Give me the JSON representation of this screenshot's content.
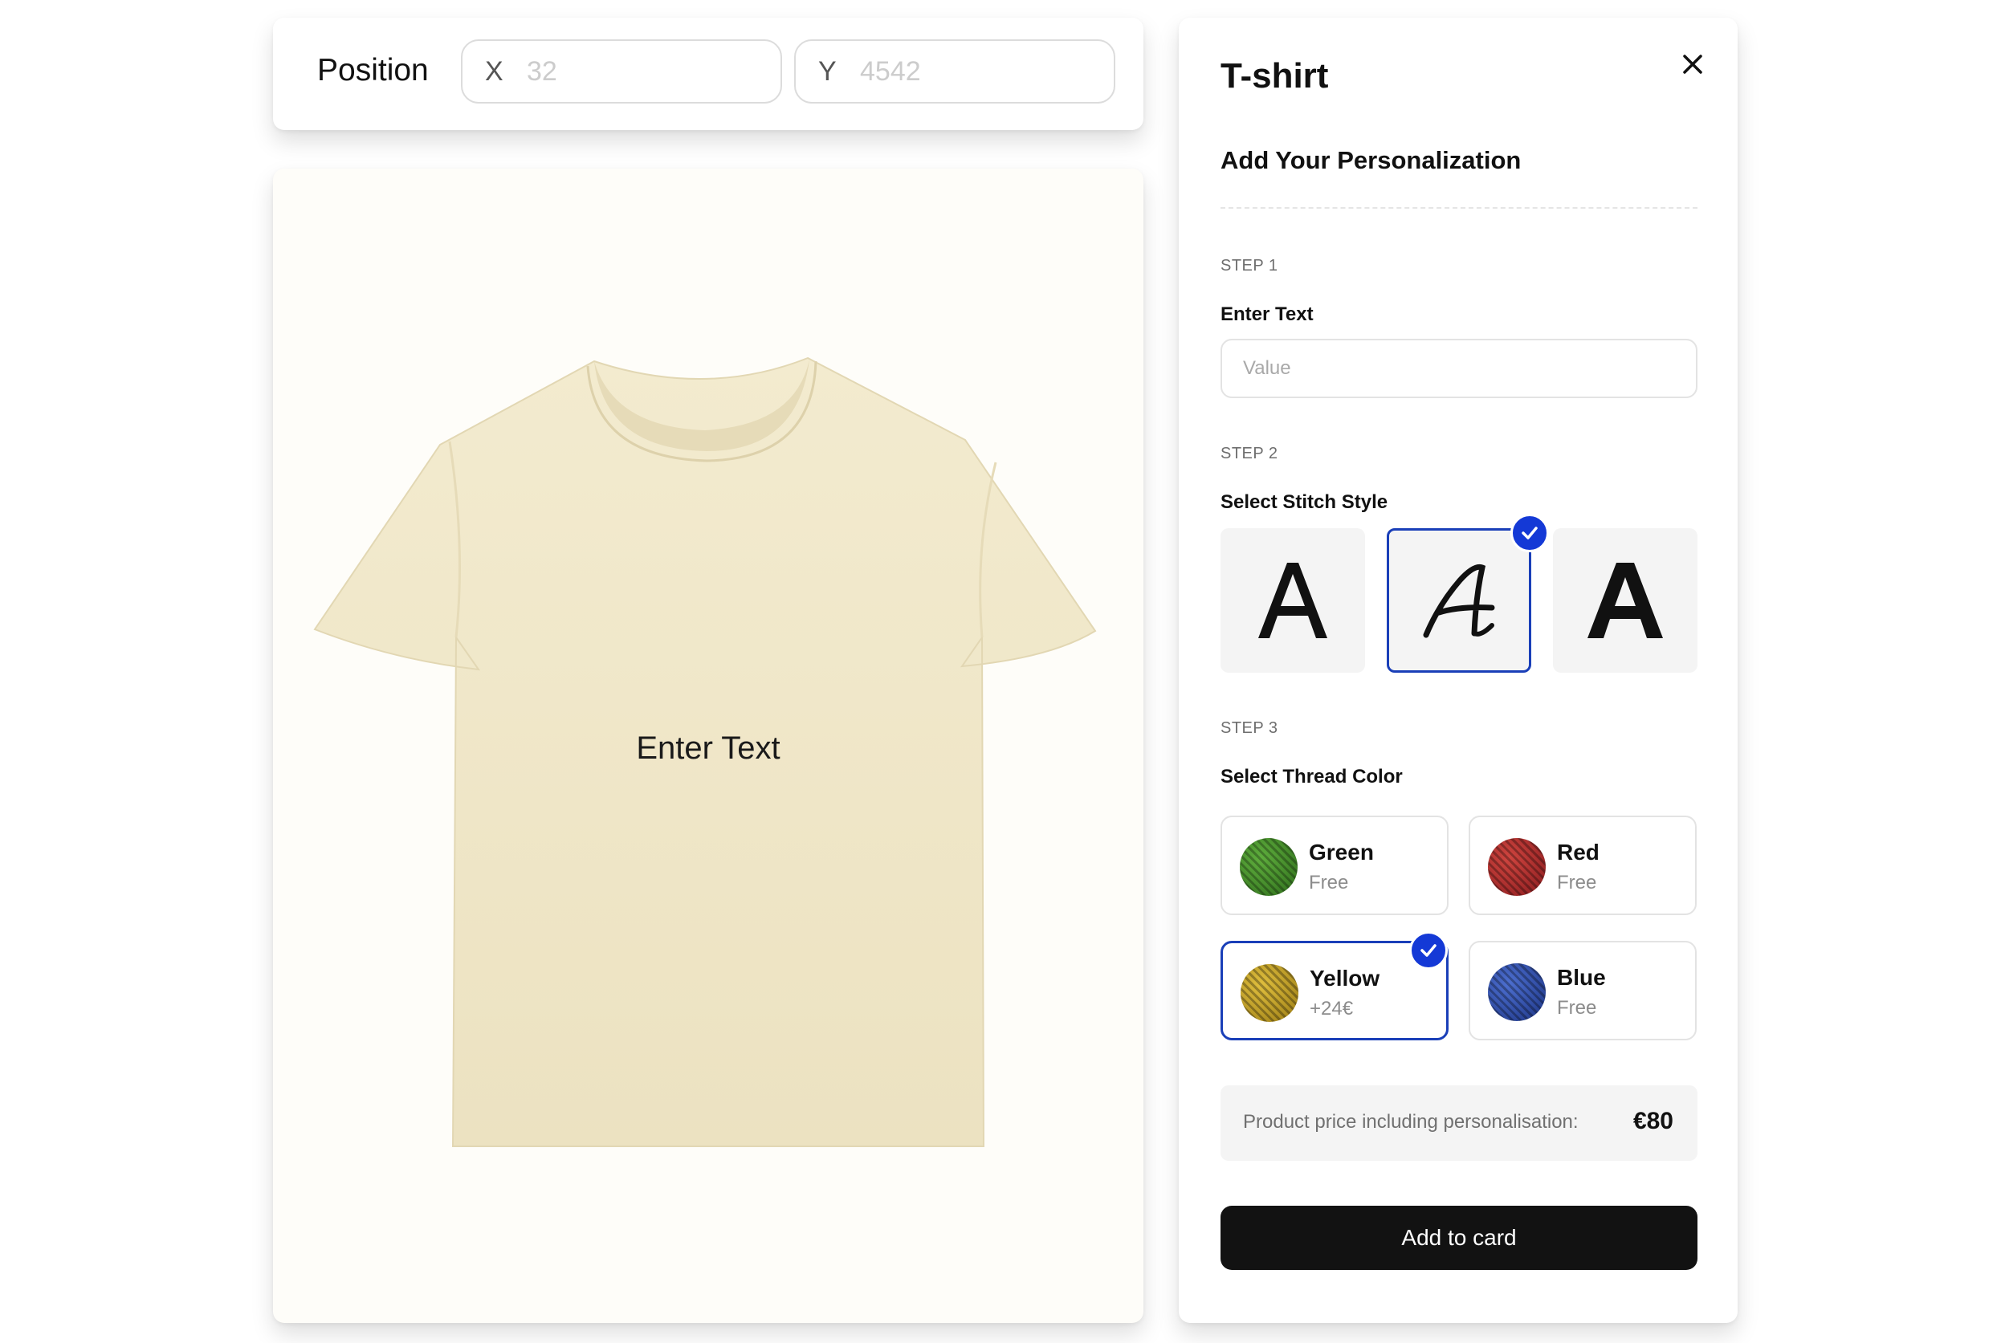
{
  "position": {
    "label": "Position",
    "x": {
      "axis": "X",
      "placeholder": "32"
    },
    "y": {
      "axis": "Y",
      "placeholder": "4542"
    }
  },
  "preview": {
    "shirt_text": "Enter Text",
    "shirt_color": "#f1e9cc"
  },
  "panel": {
    "title": "T-shirt",
    "subtitle": "Add Your Personalization",
    "step1": {
      "label": "STEP 1",
      "field_label": "Enter Text",
      "placeholder": "Value"
    },
    "step2": {
      "label": "STEP 2",
      "field_label": "Select Stitch Style",
      "options": [
        {
          "glyph": "A",
          "style": "sans",
          "selected": false
        },
        {
          "glyph": "A",
          "style": "script",
          "selected": true
        },
        {
          "glyph": "A",
          "style": "bold-sans",
          "selected": false
        }
      ]
    },
    "step3": {
      "label": "STEP 3",
      "field_label": "Select Thread Color",
      "colors": [
        {
          "name": "Green",
          "price": "Free",
          "hex": "#3c8c26",
          "selected": false
        },
        {
          "name": "Red",
          "price": "Free",
          "hex": "#b3262b",
          "selected": false
        },
        {
          "name": "Yellow",
          "price": "+24€",
          "hex": "#c8a526",
          "selected": true
        },
        {
          "name": "Blue",
          "price": "Free",
          "hex": "#2c4cb0",
          "selected": false
        }
      ]
    },
    "price": {
      "label": "Product price including personalisation:",
      "value": "€80"
    },
    "add_button": "Add to card"
  },
  "colors": {
    "accent": "#1439d6",
    "button": "#121212"
  }
}
